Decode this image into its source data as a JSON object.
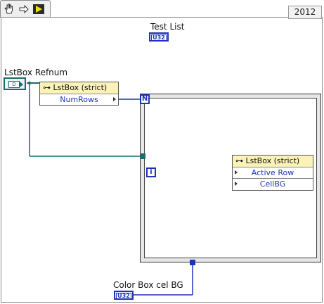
{
  "toolbar": {
    "operate_icon": "hand-icon",
    "arrow_icon": "arrow-icon",
    "run_icon": "run-icon"
  },
  "version": "2012",
  "test_list": {
    "label": "Test List",
    "type": "U32"
  },
  "refnum": {
    "label": "LstBox Refnum",
    "icon": "D"
  },
  "property_node_1": {
    "title": "LstBox (strict)",
    "property": "NumRows"
  },
  "property_node_2": {
    "title": "LstBox (strict)",
    "properties": [
      "Active Row",
      "CellBG"
    ]
  },
  "loop": {
    "count_terminal": "N",
    "iteration_terminal": "i"
  },
  "color_box": {
    "label": "Color Box cel BG",
    "type": "U32"
  },
  "colors": {
    "integer_wire": "#1f33b8",
    "refnum_wire": "#1b6b6b",
    "node_header": "#fbf2b8"
  }
}
